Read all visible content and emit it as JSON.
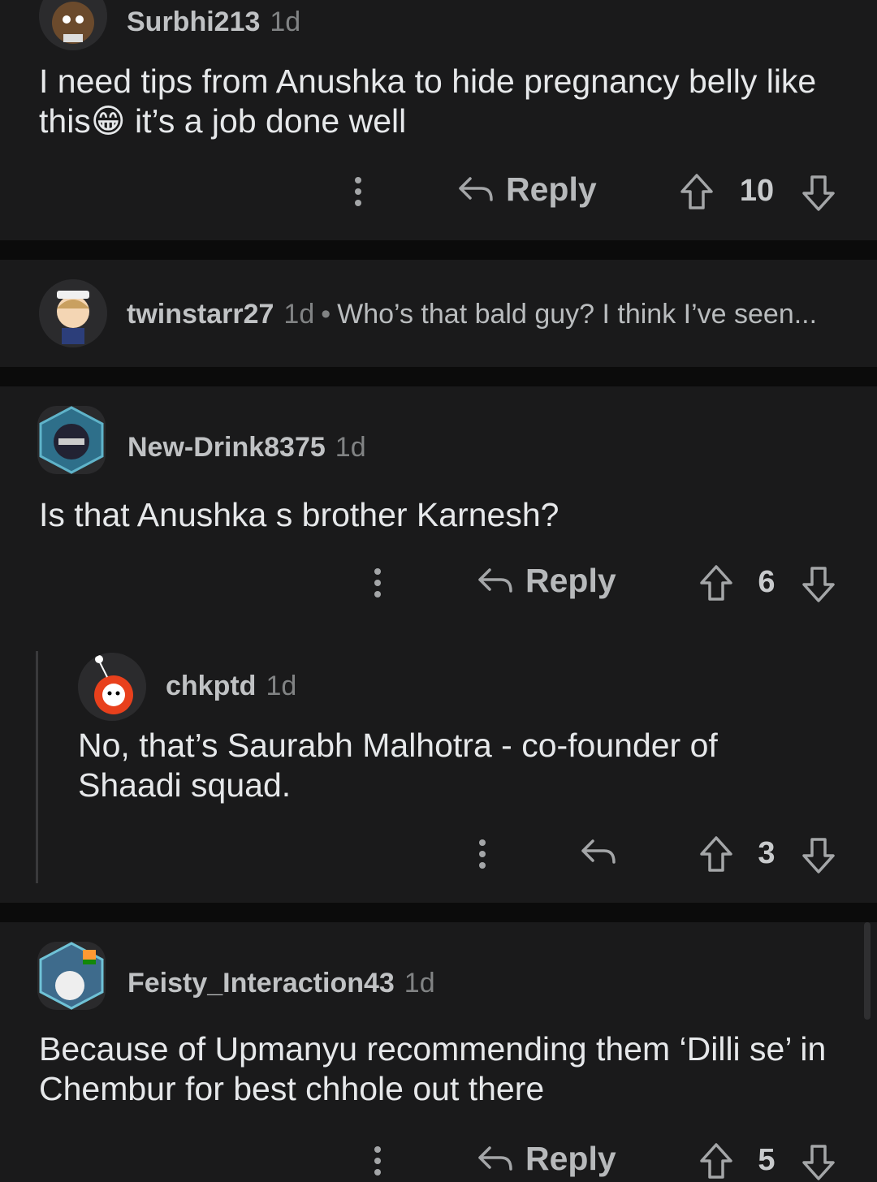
{
  "comments": [
    {
      "username": "Surbhi213",
      "time": "1d",
      "text_a": "I need tips from Anushka to hide pregnancy belly like",
      "text_b": "this",
      "emoji": "😁",
      "text_c": " it’s a job done well",
      "reply_label": "Reply",
      "score": "10"
    },
    {
      "username": "twinstarr27",
      "time": "1d",
      "separator": "•",
      "preview": "Who’s that bald guy? I think I’ve seen..."
    },
    {
      "username": "New-Drink8375",
      "time": "1d",
      "text": "Is that Anushka s brother Karnesh?",
      "reply_label": "Reply",
      "score": "6"
    },
    {
      "username": "chkptd",
      "time": "1d",
      "text": "No, that’s Saurabh Malhotra - co-founder of Shaadi squad.",
      "score": "3"
    },
    {
      "username": "Feisty_Interaction43",
      "time": "1d",
      "text": "Because of Upmanyu recommending them ‘Dilli se’ in Chembur for best chhole out there",
      "reply_label": "Reply",
      "score": "5"
    }
  ],
  "colors": {
    "background": "#0b0b0b",
    "card": "#1a1a1b",
    "text": "#d7dadc",
    "muted": "#818384"
  },
  "icons": [
    "reply-arrow-icon",
    "upvote-icon",
    "downvote-icon",
    "more-options-icon"
  ]
}
